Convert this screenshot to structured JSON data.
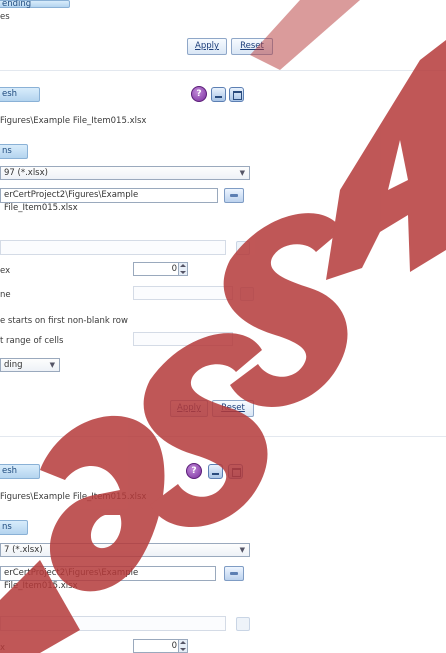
{
  "top": {
    "tab_fragment": "ending",
    "opt_fragment": "es",
    "apply": "Apply",
    "reset": "Reset"
  },
  "panel1": {
    "refresh_tab": "esh",
    "path_line": "Figures\\Example File_Item015.xlsx",
    "section_tab": "ns",
    "filetype": "97 (*.xlsx)",
    "filepath": "erCertProject2\\Figures\\Example File_Item015.xlsx",
    "index_label": "ex",
    "index_value": "0",
    "name_label": "ne",
    "nonblank_label": "e starts on first non-blank row",
    "range_label": "t range of cells",
    "dropdown_label": "ding",
    "apply": "Apply",
    "reset": "Reset"
  },
  "panel2": {
    "refresh_tab": "esh",
    "path_line": "Figures\\Example File_Item015.xlsx",
    "section_tab": "ns",
    "filetype": "7 (*.xlsx)",
    "filepath": "erCertProject2\\Figures\\Example File_Item015.xlsx",
    "index_label": "x",
    "index_value": "0"
  },
  "watermark": {
    "text": "assA",
    "color": "#b53a3a"
  }
}
